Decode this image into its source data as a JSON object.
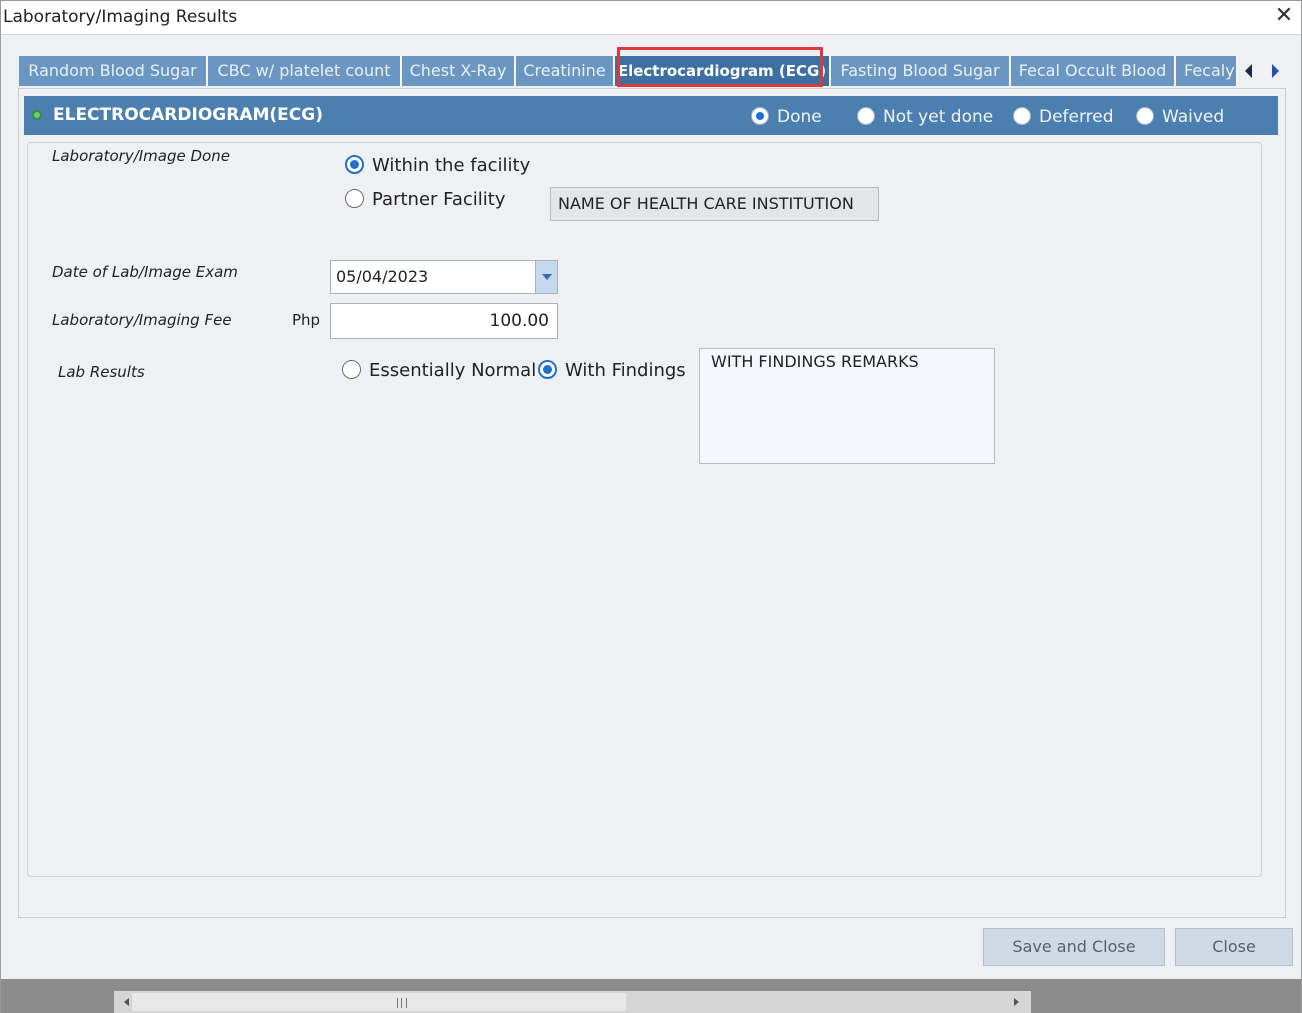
{
  "window": {
    "title": "Laboratory/Imaging Results",
    "close_glyph": "✕"
  },
  "tabs": [
    {
      "label": "Random Blood Sugar",
      "active": false
    },
    {
      "label": "CBC w/ platelet count",
      "active": false
    },
    {
      "label": "Chest X-Ray",
      "active": false
    },
    {
      "label": "Creatinine",
      "active": false
    },
    {
      "label": "Electrocardiogram (ECG)",
      "active": true
    },
    {
      "label": "Fasting Blood Sugar",
      "active": false
    },
    {
      "label": "Fecal Occult Blood",
      "active": false
    },
    {
      "label": "Fecaly",
      "active": false
    }
  ],
  "section": {
    "title": "ELECTROCARDIOGRAM(ECG)",
    "status_options": [
      {
        "label": "Done",
        "selected": true
      },
      {
        "label": "Not yet done",
        "selected": false
      },
      {
        "label": "Deferred",
        "selected": false
      },
      {
        "label": "Waived",
        "selected": false
      }
    ]
  },
  "form": {
    "lab_done_label": "Laboratory/Image Done",
    "within_facility_label": "Within the facility",
    "within_facility_selected": true,
    "partner_facility_label": "Partner Facility",
    "partner_facility_selected": false,
    "institution_name": "NAME OF HEALTH CARE INSTITUTION",
    "date_label": "Date of Lab/Image Exam",
    "date_value": "05/04/2023",
    "fee_label": "Laboratory/Imaging Fee",
    "currency": "Php",
    "fee_value": "100.00",
    "results_label": "Lab Results",
    "normal_label": "Essentially Normal",
    "normal_selected": false,
    "findings_label": "With Findings",
    "findings_selected": true,
    "remarks_value": "WITH FINDINGS REMARKS"
  },
  "buttons": {
    "save_close": "Save and Close",
    "close": "Close"
  },
  "colors": {
    "header_bg": "#4b7fb0",
    "tab_bg": "#6b96c2",
    "tab_active_bg": "#3d6fa3",
    "highlight": "#e0393b",
    "radio_on": "#1f6fcf"
  }
}
